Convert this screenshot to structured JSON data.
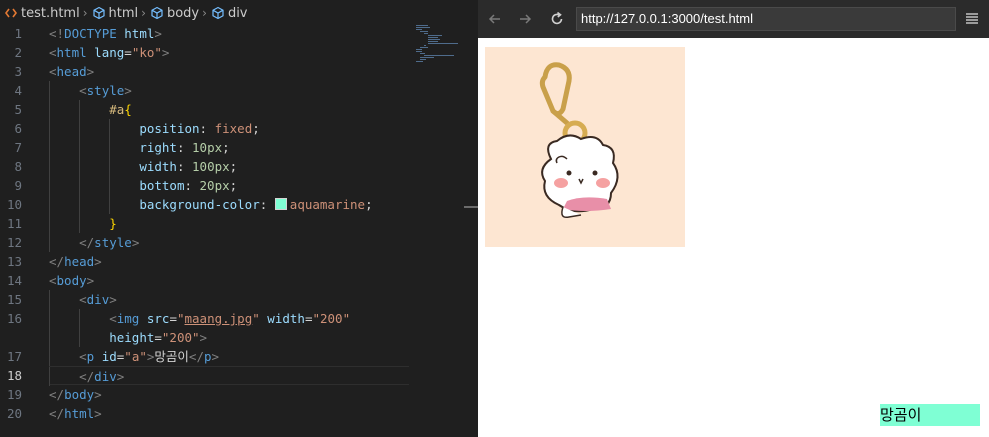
{
  "breadcrumbs": {
    "file": "test.html",
    "items": [
      "html",
      "body",
      "div"
    ]
  },
  "code_lines": [
    {
      "n": "1",
      "tokens": [
        [
          "t-punct",
          "<!"
        ],
        [
          "t-tag",
          "DOCTYPE"
        ],
        [
          "t-text",
          " "
        ],
        [
          "t-attr",
          "html"
        ],
        [
          "t-punct",
          ">"
        ]
      ]
    },
    {
      "n": "2",
      "tokens": [
        [
          "t-punct",
          "<"
        ],
        [
          "t-tag",
          "html"
        ],
        [
          "t-text",
          " "
        ],
        [
          "t-attr",
          "lang"
        ],
        [
          "t-text",
          "="
        ],
        [
          "t-str",
          "\"ko\""
        ],
        [
          "t-punct",
          ">"
        ]
      ]
    },
    {
      "n": "3",
      "tokens": [
        [
          "t-punct",
          "<"
        ],
        [
          "t-tag",
          "head"
        ],
        [
          "t-punct",
          ">"
        ]
      ]
    },
    {
      "n": "4",
      "guides": 1,
      "tokens": [
        [
          "t-text",
          "    "
        ],
        [
          "t-punct",
          "<"
        ],
        [
          "t-tag",
          "style"
        ],
        [
          "t-punct",
          ">"
        ]
      ]
    },
    {
      "n": "5",
      "guides": 2,
      "tokens": [
        [
          "t-text",
          "        "
        ],
        [
          "t-sel",
          "#a"
        ],
        [
          "t-brace",
          "{"
        ]
      ]
    },
    {
      "n": "6",
      "guides": 3,
      "tokens": [
        [
          "t-text",
          "            "
        ],
        [
          "t-prop",
          "position"
        ],
        [
          "t-text",
          ": "
        ],
        [
          "t-val",
          "fixed"
        ],
        [
          "t-text",
          ";"
        ]
      ]
    },
    {
      "n": "7",
      "guides": 3,
      "tokens": [
        [
          "t-text",
          "            "
        ],
        [
          "t-prop",
          "right"
        ],
        [
          "t-text",
          ": "
        ],
        [
          "t-num",
          "10px"
        ],
        [
          "t-text",
          ";"
        ]
      ]
    },
    {
      "n": "8",
      "guides": 3,
      "tokens": [
        [
          "t-text",
          "            "
        ],
        [
          "t-prop",
          "width"
        ],
        [
          "t-text",
          ": "
        ],
        [
          "t-num",
          "100px"
        ],
        [
          "t-text",
          ";"
        ]
      ]
    },
    {
      "n": "9",
      "guides": 3,
      "tokens": [
        [
          "t-text",
          "            "
        ],
        [
          "t-prop",
          "bottom"
        ],
        [
          "t-text",
          ": "
        ],
        [
          "t-num",
          "20px"
        ],
        [
          "t-text",
          ";"
        ]
      ]
    },
    {
      "n": "10",
      "guides": 3,
      "swatch": true,
      "tokens": [
        [
          "t-text",
          "            "
        ],
        [
          "t-prop",
          "background-color"
        ],
        [
          "t-text",
          ": "
        ],
        [
          "swatch",
          ""
        ],
        [
          "t-val",
          "aquamarine"
        ],
        [
          "t-text",
          ";"
        ]
      ]
    },
    {
      "n": "11",
      "guides": 2,
      "tokens": [
        [
          "t-text",
          "        "
        ],
        [
          "t-brace",
          "}"
        ]
      ]
    },
    {
      "n": "12",
      "guides": 1,
      "tokens": [
        [
          "t-text",
          "    "
        ],
        [
          "t-punct",
          "</"
        ],
        [
          "t-tag",
          "style"
        ],
        [
          "t-punct",
          ">"
        ]
      ]
    },
    {
      "n": "13",
      "tokens": [
        [
          "t-punct",
          "</"
        ],
        [
          "t-tag",
          "head"
        ],
        [
          "t-punct",
          ">"
        ]
      ]
    },
    {
      "n": "14",
      "tokens": [
        [
          "t-punct",
          "<"
        ],
        [
          "t-tag",
          "body"
        ],
        [
          "t-punct",
          ">"
        ]
      ]
    },
    {
      "n": "15",
      "guides": 1,
      "tokens": [
        [
          "t-text",
          "    "
        ],
        [
          "t-punct",
          "<"
        ],
        [
          "t-tag",
          "div"
        ],
        [
          "t-punct",
          ">"
        ]
      ]
    },
    {
      "n": "16",
      "guides": 2,
      "tokens": [
        [
          "t-text",
          "        "
        ],
        [
          "t-punct",
          "<"
        ],
        [
          "t-tag",
          "img"
        ],
        [
          "t-text",
          " "
        ],
        [
          "t-attr",
          "src"
        ],
        [
          "t-text",
          "="
        ],
        [
          "t-str",
          "\""
        ],
        [
          "t-str-u",
          "maang.jpg"
        ],
        [
          "t-str",
          "\""
        ],
        [
          "t-text",
          " "
        ],
        [
          "t-attr",
          "width"
        ],
        [
          "t-text",
          "="
        ],
        [
          "t-str",
          "\"200\""
        ]
      ]
    },
    {
      "n": "",
      "guides": 2,
      "tokens": [
        [
          "t-text",
          "        "
        ],
        [
          "t-attr",
          "height"
        ],
        [
          "t-text",
          "="
        ],
        [
          "t-str",
          "\"200\""
        ],
        [
          "t-punct",
          ">"
        ]
      ]
    },
    {
      "n": "17",
      "guides": 1,
      "tokens": [
        [
          "t-text",
          "    "
        ],
        [
          "t-punct",
          "<"
        ],
        [
          "t-tag",
          "p"
        ],
        [
          "t-text",
          " "
        ],
        [
          "t-attr",
          "id"
        ],
        [
          "t-text",
          "="
        ],
        [
          "t-str",
          "\"a\""
        ],
        [
          "t-punct",
          ">"
        ],
        [
          "t-text",
          "망곰이"
        ],
        [
          "t-punct",
          "</"
        ],
        [
          "t-tag",
          "p"
        ],
        [
          "t-punct",
          ">"
        ]
      ]
    },
    {
      "n": "18",
      "guides": 1,
      "current": true,
      "tokens": [
        [
          "t-text",
          "    "
        ],
        [
          "t-punct",
          "</"
        ],
        [
          "t-tag",
          "div"
        ],
        [
          "t-punct",
          ">"
        ]
      ]
    },
    {
      "n": "19",
      "tokens": [
        [
          "t-punct",
          "</"
        ],
        [
          "t-tag",
          "body"
        ],
        [
          "t-punct",
          ">"
        ]
      ]
    },
    {
      "n": "20",
      "tokens": [
        [
          "t-punct",
          "</"
        ],
        [
          "t-tag",
          "html"
        ],
        [
          "t-punct",
          ">"
        ]
      ]
    }
  ],
  "browser": {
    "url": "http://127.0.0.1:3000/test.html",
    "fixed_text": "망곰이",
    "fixed_bg": "#7fffd4",
    "image_bg": "#fde6d2"
  },
  "icons": {
    "back": "arrow-left-icon",
    "forward": "arrow-right-icon",
    "reload": "reload-icon",
    "menu": "hamburger-menu-icon"
  }
}
